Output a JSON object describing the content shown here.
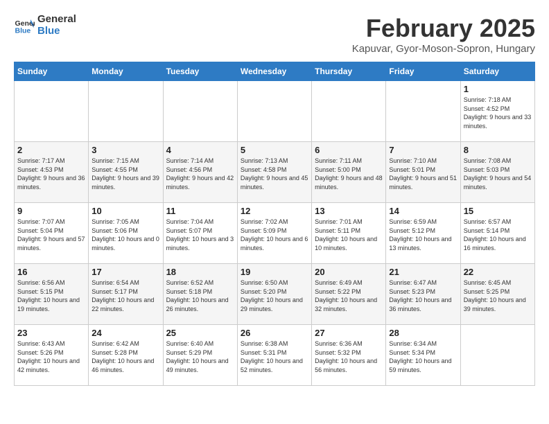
{
  "header": {
    "logo_line1": "General",
    "logo_line2": "Blue",
    "title": "February 2025",
    "subtitle": "Kapuvar, Gyor-Moson-Sopron, Hungary"
  },
  "weekdays": [
    "Sunday",
    "Monday",
    "Tuesday",
    "Wednesday",
    "Thursday",
    "Friday",
    "Saturday"
  ],
  "weeks": [
    [
      {
        "day": "",
        "info": ""
      },
      {
        "day": "",
        "info": ""
      },
      {
        "day": "",
        "info": ""
      },
      {
        "day": "",
        "info": ""
      },
      {
        "day": "",
        "info": ""
      },
      {
        "day": "",
        "info": ""
      },
      {
        "day": "1",
        "info": "Sunrise: 7:18 AM\nSunset: 4:52 PM\nDaylight: 9 hours and 33 minutes."
      }
    ],
    [
      {
        "day": "2",
        "info": "Sunrise: 7:17 AM\nSunset: 4:53 PM\nDaylight: 9 hours and 36 minutes."
      },
      {
        "day": "3",
        "info": "Sunrise: 7:15 AM\nSunset: 4:55 PM\nDaylight: 9 hours and 39 minutes."
      },
      {
        "day": "4",
        "info": "Sunrise: 7:14 AM\nSunset: 4:56 PM\nDaylight: 9 hours and 42 minutes."
      },
      {
        "day": "5",
        "info": "Sunrise: 7:13 AM\nSunset: 4:58 PM\nDaylight: 9 hours and 45 minutes."
      },
      {
        "day": "6",
        "info": "Sunrise: 7:11 AM\nSunset: 5:00 PM\nDaylight: 9 hours and 48 minutes."
      },
      {
        "day": "7",
        "info": "Sunrise: 7:10 AM\nSunset: 5:01 PM\nDaylight: 9 hours and 51 minutes."
      },
      {
        "day": "8",
        "info": "Sunrise: 7:08 AM\nSunset: 5:03 PM\nDaylight: 9 hours and 54 minutes."
      }
    ],
    [
      {
        "day": "9",
        "info": "Sunrise: 7:07 AM\nSunset: 5:04 PM\nDaylight: 9 hours and 57 minutes."
      },
      {
        "day": "10",
        "info": "Sunrise: 7:05 AM\nSunset: 5:06 PM\nDaylight: 10 hours and 0 minutes."
      },
      {
        "day": "11",
        "info": "Sunrise: 7:04 AM\nSunset: 5:07 PM\nDaylight: 10 hours and 3 minutes."
      },
      {
        "day": "12",
        "info": "Sunrise: 7:02 AM\nSunset: 5:09 PM\nDaylight: 10 hours and 6 minutes."
      },
      {
        "day": "13",
        "info": "Sunrise: 7:01 AM\nSunset: 5:11 PM\nDaylight: 10 hours and 10 minutes."
      },
      {
        "day": "14",
        "info": "Sunrise: 6:59 AM\nSunset: 5:12 PM\nDaylight: 10 hours and 13 minutes."
      },
      {
        "day": "15",
        "info": "Sunrise: 6:57 AM\nSunset: 5:14 PM\nDaylight: 10 hours and 16 minutes."
      }
    ],
    [
      {
        "day": "16",
        "info": "Sunrise: 6:56 AM\nSunset: 5:15 PM\nDaylight: 10 hours and 19 minutes."
      },
      {
        "day": "17",
        "info": "Sunrise: 6:54 AM\nSunset: 5:17 PM\nDaylight: 10 hours and 22 minutes."
      },
      {
        "day": "18",
        "info": "Sunrise: 6:52 AM\nSunset: 5:18 PM\nDaylight: 10 hours and 26 minutes."
      },
      {
        "day": "19",
        "info": "Sunrise: 6:50 AM\nSunset: 5:20 PM\nDaylight: 10 hours and 29 minutes."
      },
      {
        "day": "20",
        "info": "Sunrise: 6:49 AM\nSunset: 5:22 PM\nDaylight: 10 hours and 32 minutes."
      },
      {
        "day": "21",
        "info": "Sunrise: 6:47 AM\nSunset: 5:23 PM\nDaylight: 10 hours and 36 minutes."
      },
      {
        "day": "22",
        "info": "Sunrise: 6:45 AM\nSunset: 5:25 PM\nDaylight: 10 hours and 39 minutes."
      }
    ],
    [
      {
        "day": "23",
        "info": "Sunrise: 6:43 AM\nSunset: 5:26 PM\nDaylight: 10 hours and 42 minutes."
      },
      {
        "day": "24",
        "info": "Sunrise: 6:42 AM\nSunset: 5:28 PM\nDaylight: 10 hours and 46 minutes."
      },
      {
        "day": "25",
        "info": "Sunrise: 6:40 AM\nSunset: 5:29 PM\nDaylight: 10 hours and 49 minutes."
      },
      {
        "day": "26",
        "info": "Sunrise: 6:38 AM\nSunset: 5:31 PM\nDaylight: 10 hours and 52 minutes."
      },
      {
        "day": "27",
        "info": "Sunrise: 6:36 AM\nSunset: 5:32 PM\nDaylight: 10 hours and 56 minutes."
      },
      {
        "day": "28",
        "info": "Sunrise: 6:34 AM\nSunset: 5:34 PM\nDaylight: 10 hours and 59 minutes."
      },
      {
        "day": "",
        "info": ""
      }
    ]
  ]
}
